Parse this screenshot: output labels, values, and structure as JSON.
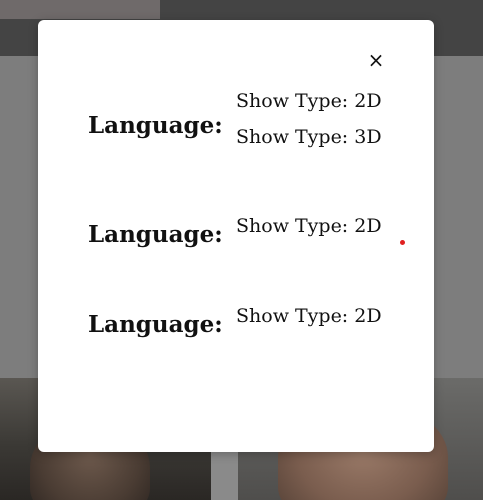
{
  "modal": {
    "close_label": "×",
    "rows": [
      {
        "language_label": "Language:",
        "show_types": [
          "Show Type: 2D",
          "Show Type: 3D"
        ]
      },
      {
        "language_label": "Language:",
        "show_types": [
          "Show Type: 2D"
        ]
      },
      {
        "language_label": "Language:",
        "show_types": [
          "Show Type: 2D"
        ]
      }
    ]
  },
  "colors": {
    "overlay_dark": "#444444",
    "modal_bg": "#ffffff",
    "text": "#111111",
    "cursor_dot": "#e02020"
  }
}
